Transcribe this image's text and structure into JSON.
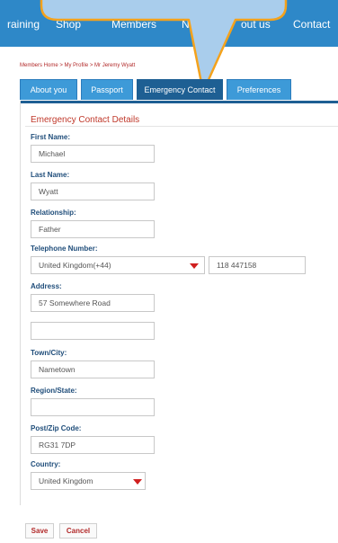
{
  "nav": {
    "items": [
      "raining",
      "Shop",
      "Members",
      "New",
      "out us",
      "Contact"
    ]
  },
  "breadcrumb": "Members Home > My Profile > Mr Jeremy Wyatt",
  "tabs": [
    {
      "label": "About you",
      "active": false
    },
    {
      "label": "Passport",
      "active": false
    },
    {
      "label": "Emergency Contact",
      "active": true
    },
    {
      "label": "Preferences",
      "active": false
    }
  ],
  "section_title": "Emergency Contact Details",
  "fields": {
    "first_name": {
      "label": "First Name:",
      "value": "Michael"
    },
    "last_name": {
      "label": "Last Name:",
      "value": "Wyatt"
    },
    "relationship": {
      "label": "Relationship:",
      "value": "Father"
    },
    "telephone": {
      "label": "Telephone Number:",
      "country_code": "United Kingdom(+44)",
      "number": "118 447158"
    },
    "address": {
      "label": "Address:",
      "line1": "57 Somewhere Road",
      "line2": ""
    },
    "town": {
      "label": "Town/City:",
      "value": "Nametown"
    },
    "region": {
      "label": "Region/State:",
      "value": ""
    },
    "postcode": {
      "label": "Post/Zip Code:",
      "value": "RG31 7DP"
    },
    "country": {
      "label": "Country:",
      "value": "United Kingdom"
    }
  },
  "buttons": {
    "save": "Save",
    "cancel": "Cancel"
  },
  "colors": {
    "nav": "#2e88c8",
    "tab_active": "#1e5f93",
    "callout_fill": "#a9cdec",
    "callout_border": "#f4a21c",
    "accent": "#c0392b"
  }
}
